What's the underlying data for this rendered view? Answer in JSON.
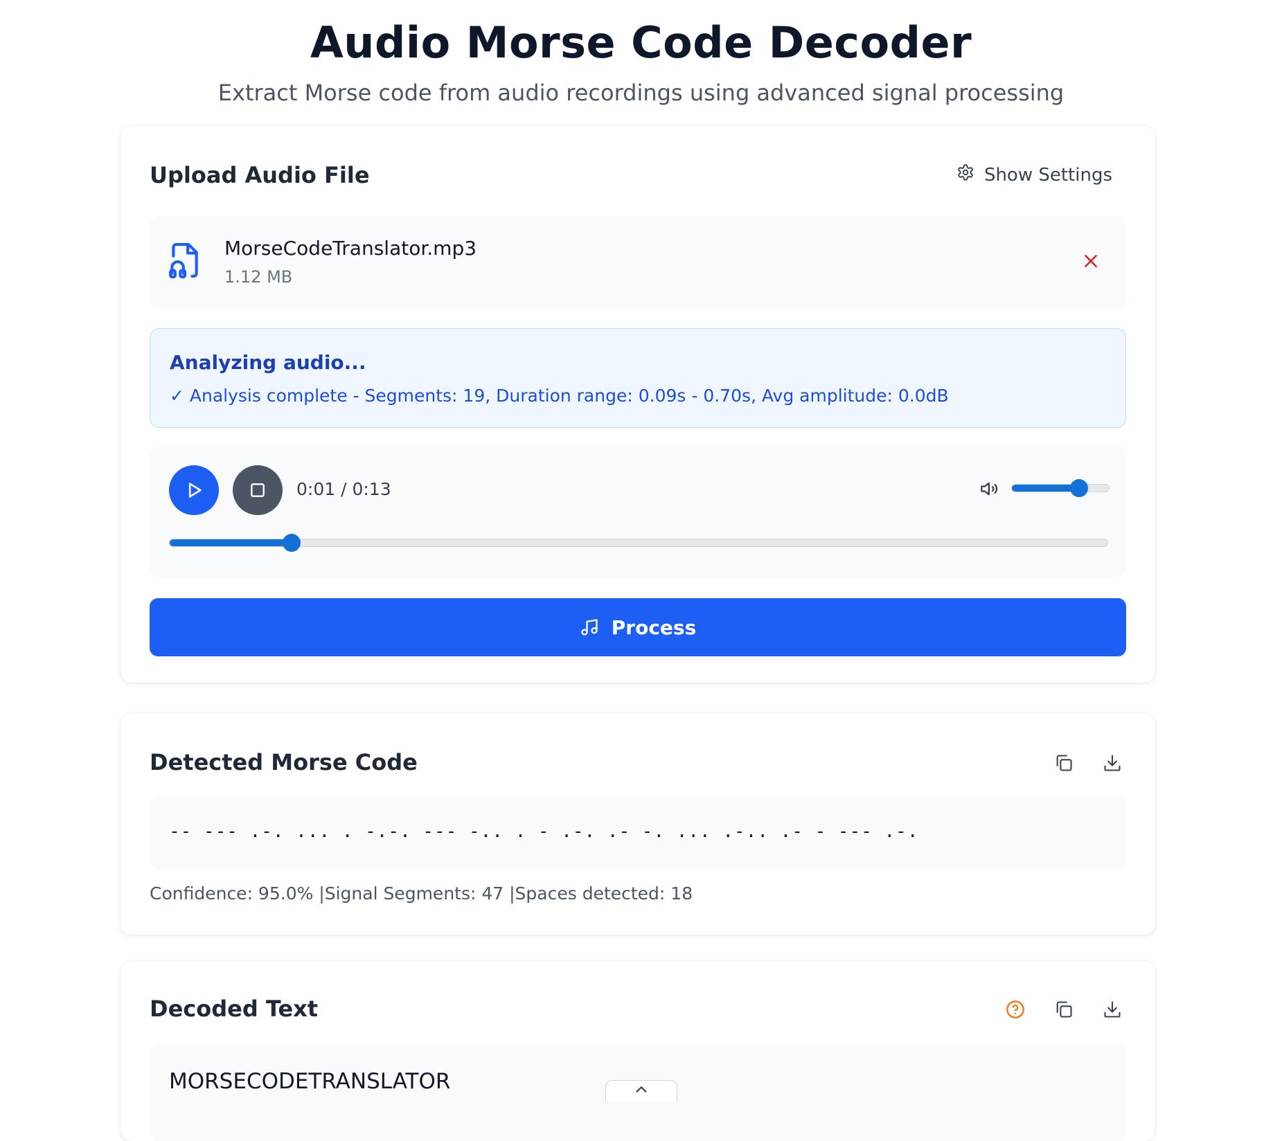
{
  "header": {
    "title": "Audio Morse Code Decoder",
    "subtitle": "Extract Morse code from audio recordings using advanced signal processing"
  },
  "upload": {
    "title": "Upload Audio File",
    "settings_label": "Show Settings",
    "file": {
      "name": "MorseCodeTranslator.mp3",
      "size": "1.12 MB"
    },
    "status": {
      "title": "Analyzing audio...",
      "detail": "✓ Analysis complete - Segments: 19, Duration range: 0.09s - 0.70s, Avg amplitude: 0.0dB"
    },
    "player": {
      "time": "0:01 / 0:13",
      "progress_fraction": 0.13,
      "volume_fraction": 0.68
    },
    "process_label": "Process"
  },
  "morse": {
    "title": "Detected Morse Code",
    "code": "-- --- .-. ... . -.-. --- -.. . - .-. .- -. ... .-.. .- - --- .-.",
    "stats": "Confidence: 95.0% |Signal Segments: 47 |Spaces detected: 18"
  },
  "decoded": {
    "title": "Decoded Text",
    "text": "MORSECODETRANSLATOR"
  },
  "colors": {
    "primary": "#1d5ff5",
    "slider": "#1270d6",
    "danger": "#dc2626",
    "help": "#f97316"
  }
}
